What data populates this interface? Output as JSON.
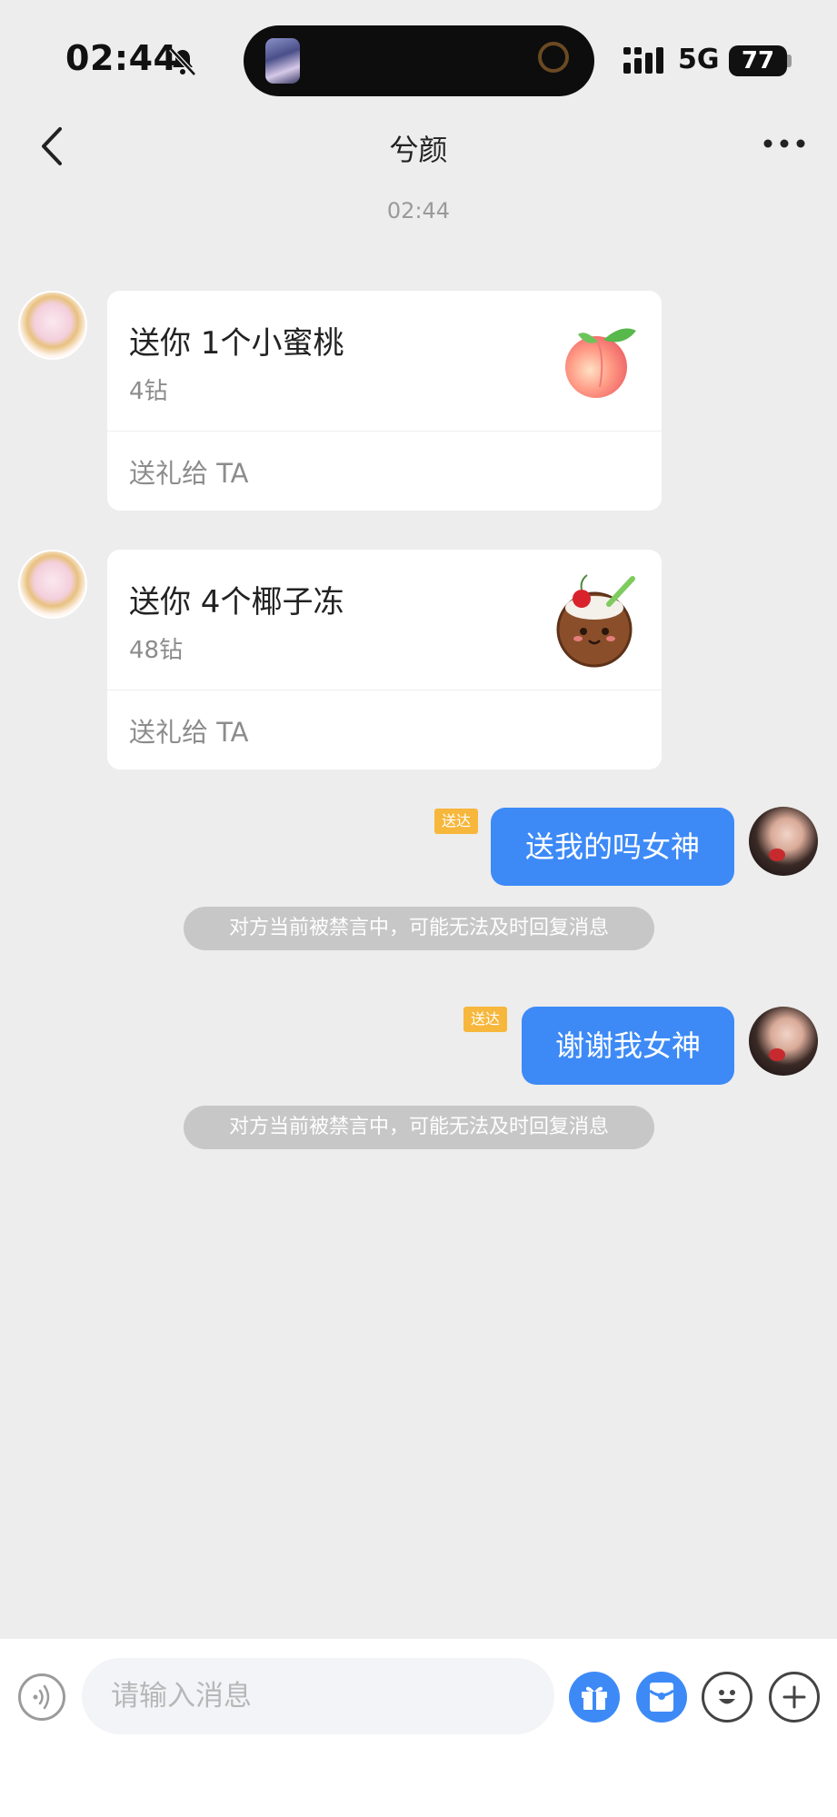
{
  "status_bar": {
    "time": "02:44",
    "network": "5G",
    "battery": "77"
  },
  "header": {
    "title": "兮颜",
    "timestamp": "02:44"
  },
  "gifts": [
    {
      "title": "送你 1个小蜜桃",
      "price": "4钻",
      "action": "送礼给 TA",
      "icon": "peach-icon"
    },
    {
      "title": "送你 4个椰子冻",
      "price": "48钻",
      "action": "送礼给 TA",
      "icon": "coconut-jelly-icon"
    }
  ],
  "messages": [
    {
      "badge": "送达",
      "text": "送我的吗女神",
      "notice": "对方当前被禁言中，可能无法及时回复消息"
    },
    {
      "badge": "送达",
      "text": "谢谢我女神",
      "notice": "对方当前被禁言中，可能无法及时回复消息"
    }
  ],
  "composer": {
    "placeholder": "请输入消息"
  },
  "colors": {
    "accent": "#3d8af7",
    "badge": "#f6b73c",
    "background": "#ededed"
  }
}
